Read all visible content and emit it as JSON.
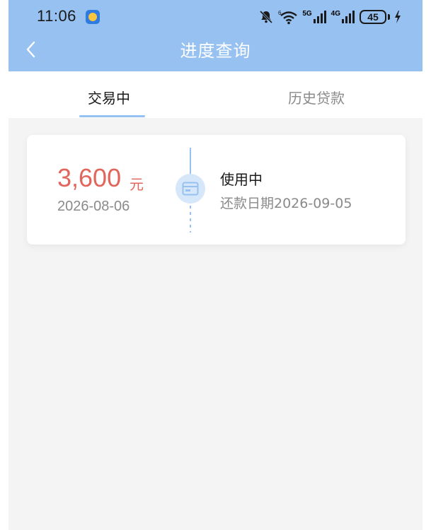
{
  "status_bar": {
    "time": "11:06",
    "network_5g": "5G",
    "network_4g": "4G",
    "battery": "45"
  },
  "nav": {
    "title": "进度查询"
  },
  "tabs": [
    {
      "label": "交易中",
      "active": true
    },
    {
      "label": "历史贷款",
      "active": false
    }
  ],
  "loan_card": {
    "amount": "3,600",
    "currency": "元",
    "date": "2026-08-06",
    "status": "使用中",
    "repay_date": "还款日期2026-09-05"
  },
  "colors": {
    "header": "#97c1f0",
    "amount": "#e2655c",
    "background": "#f4f4f4"
  }
}
